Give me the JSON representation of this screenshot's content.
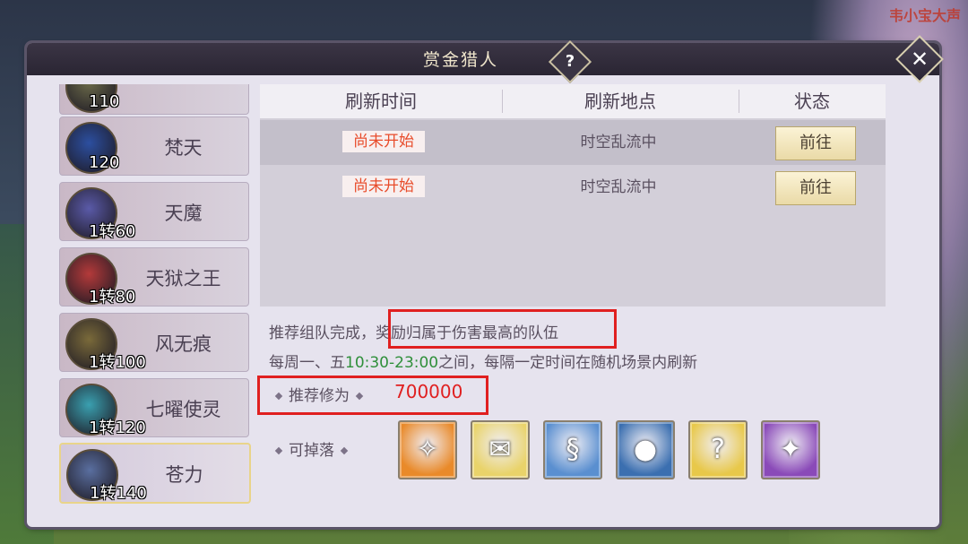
{
  "watermark": "韦小宝大声",
  "window": {
    "title": "赏金猎人",
    "help_label": "?",
    "close_label": "✕"
  },
  "bosses": [
    {
      "name": "",
      "level": "110",
      "color": "#6b6a4a"
    },
    {
      "name": "梵天",
      "level": "120",
      "color": "#2c4fa0"
    },
    {
      "name": "天魔",
      "level": "1转60",
      "color": "#5a5aa8"
    },
    {
      "name": "天狱之王",
      "level": "1转80",
      "color": "#b43a3a"
    },
    {
      "name": "风无痕",
      "level": "1转100",
      "color": "#7a6a3a"
    },
    {
      "name": "七曜使灵",
      "level": "1转120",
      "color": "#3aa0b0"
    },
    {
      "name": "苍力",
      "level": "1转140",
      "color": "#5a6fa0"
    }
  ],
  "table": {
    "headers": [
      "刷新时间",
      "刷新地点",
      "状态"
    ],
    "rows": [
      {
        "time": "尚未开始",
        "location": "时空乱流中",
        "action": "前往"
      },
      {
        "time": "尚未开始",
        "location": "时空乱流中",
        "action": "前往"
      }
    ]
  },
  "info": {
    "line1_prefix": "推荐组队完成，",
    "line1_highlight": "奖励归属于伤害最高的队伍",
    "line2_prefix": "每周一、五",
    "line2_time": "10:30-23:00",
    "line2_suffix": "之间，每隔一定时间在随机场景内刷新",
    "recommend_label": "推荐修为",
    "recommend_value": "700000",
    "drops_label": "可掉落"
  },
  "drops": [
    {
      "icon": "gold-necklace-icon",
      "glyph": "✧",
      "bg": "#e98a2a"
    },
    {
      "icon": "scroll-icon",
      "glyph": "✉",
      "bg": "#e9d36a"
    },
    {
      "icon": "skill-scroll-icon",
      "glyph": "§",
      "bg": "#5a8fd0"
    },
    {
      "icon": "blue-orb-icon",
      "glyph": "●",
      "bg": "#3b6fb0"
    },
    {
      "icon": "mystery-orb-icon",
      "glyph": "?",
      "bg": "#e8c84a"
    },
    {
      "icon": "purple-scroll-icon",
      "glyph": "✦",
      "bg": "#8a4ab8"
    }
  ]
}
